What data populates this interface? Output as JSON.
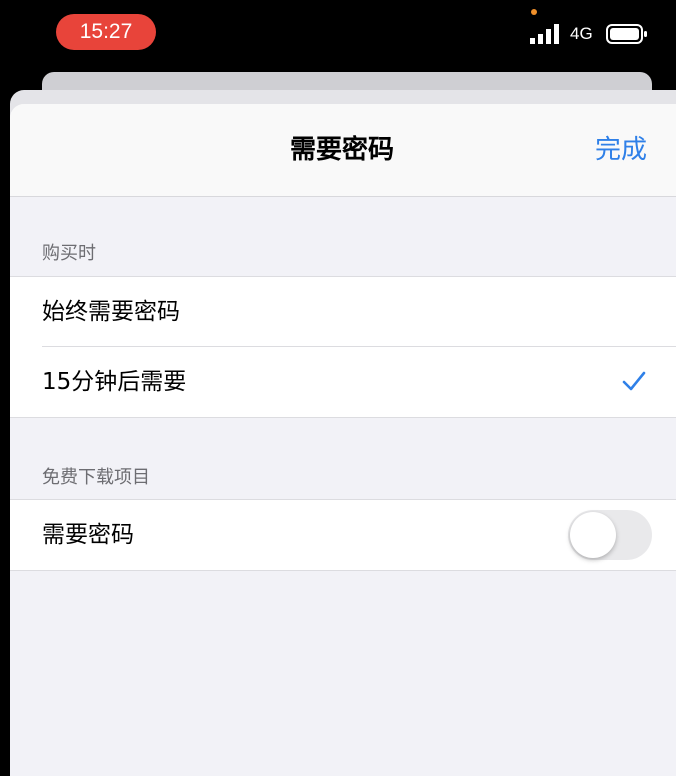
{
  "status_bar": {
    "time": "15:27",
    "network": "4G",
    "icons": [
      "privacy-dot",
      "cellular-signal-icon",
      "battery-icon"
    ]
  },
  "nav": {
    "title": "需要密码",
    "done_label": "完成"
  },
  "sections": [
    {
      "header": "购买时",
      "rows": [
        {
          "label": "始终需要密码",
          "selected": false
        },
        {
          "label": "15分钟后需要",
          "selected": true
        }
      ]
    },
    {
      "header": "免费下载项目",
      "rows": [
        {
          "label": "需要密码",
          "toggle_on": false
        }
      ]
    }
  ],
  "colors": {
    "time_pill": "#e8443a",
    "privacy_dot": "#f0902a",
    "accent": "#2f80e8",
    "grouped_background": "#f2f2f7"
  }
}
